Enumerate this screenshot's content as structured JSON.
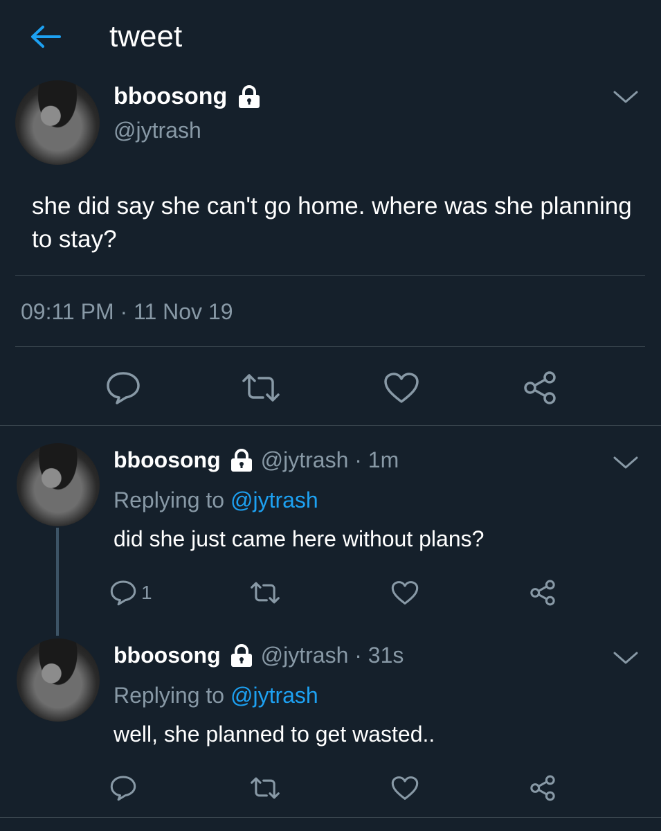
{
  "header": {
    "title": "tweet",
    "back_icon": "arrow-left-icon",
    "accent": "#1da1f2"
  },
  "main_tweet": {
    "display_name": "bboosong",
    "handle": "@jytrash",
    "text": "she did say she can't go home. where was she planning to stay?",
    "timestamp": "09:11 PM · 11 Nov 19",
    "actions": [
      "reply-icon",
      "retweet-icon",
      "like-icon",
      "share-icon"
    ]
  },
  "replies": [
    {
      "display_name": "bboosong",
      "handle_time": "@jytrash · 1m",
      "replying_prefix": "Replying to ",
      "replying_to": "@jytrash",
      "text": "did she just came here without plans?",
      "reply_count": "1"
    },
    {
      "display_name": "bboosong",
      "handle_time": "@jytrash · 31s",
      "replying_prefix": "Replying to ",
      "replying_to": "@jytrash",
      "text": "well, she planned to get wasted.."
    }
  ],
  "colors": {
    "background": "#15202b",
    "secondary_text": "#8899a6",
    "divider": "#38444d",
    "link": "#1da1f2"
  }
}
